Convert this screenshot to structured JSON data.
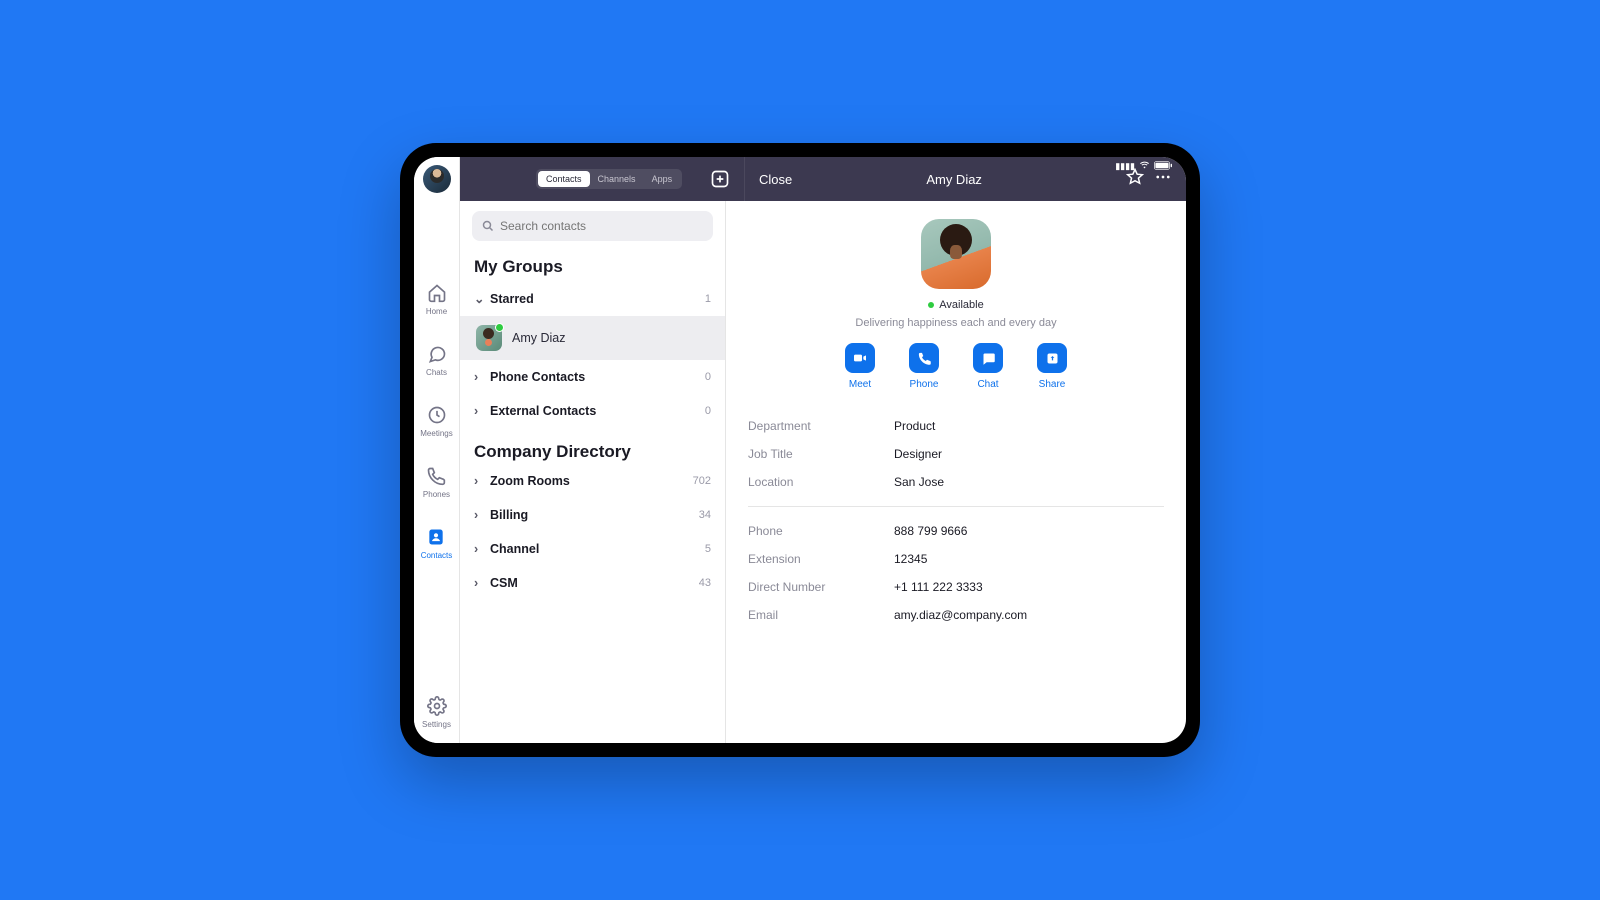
{
  "header": {
    "tabs": [
      "Contacts",
      "Channels",
      "Apps"
    ],
    "close": "Close",
    "contact_name": "Amy Diaz"
  },
  "nav": {
    "home": "Home",
    "chats": "Chats",
    "meetings": "Meetings",
    "phones": "Phones",
    "contacts": "Contacts",
    "settings": "Settings"
  },
  "search": {
    "placeholder": "Search contacts"
  },
  "groups": {
    "title": "My Groups",
    "starred": {
      "label": "Starred",
      "count": "1"
    },
    "starred_contact": "Amy Diaz",
    "phone_contacts": {
      "label": "Phone Contacts",
      "count": "0"
    },
    "external_contacts": {
      "label": "External Contacts",
      "count": "0"
    }
  },
  "directory": {
    "title": "Company Directory",
    "items": [
      {
        "label": "Zoom Rooms",
        "count": "702"
      },
      {
        "label": "Billing",
        "count": "34"
      },
      {
        "label": "Channel",
        "count": "5"
      },
      {
        "label": "CSM",
        "count": "43"
      }
    ]
  },
  "detail": {
    "status": "Available",
    "tagline": "Delivering happiness each and every day",
    "actions": {
      "meet": "Meet",
      "phone": "Phone",
      "chat": "Chat",
      "share": "Share"
    },
    "fields1": {
      "department": {
        "k": "Department",
        "v": "Product"
      },
      "job": {
        "k": "Job Title",
        "v": "Designer"
      },
      "location": {
        "k": "Location",
        "v": "San Jose"
      }
    },
    "fields2": {
      "phone": {
        "k": "Phone",
        "v": "888 799 9666"
      },
      "ext": {
        "k": "Extension",
        "v": "12345"
      },
      "direct": {
        "k": "Direct Number",
        "v": "+1 111 222 3333"
      },
      "email": {
        "k": "Email",
        "v": "amy.diaz@company.com"
      }
    }
  }
}
